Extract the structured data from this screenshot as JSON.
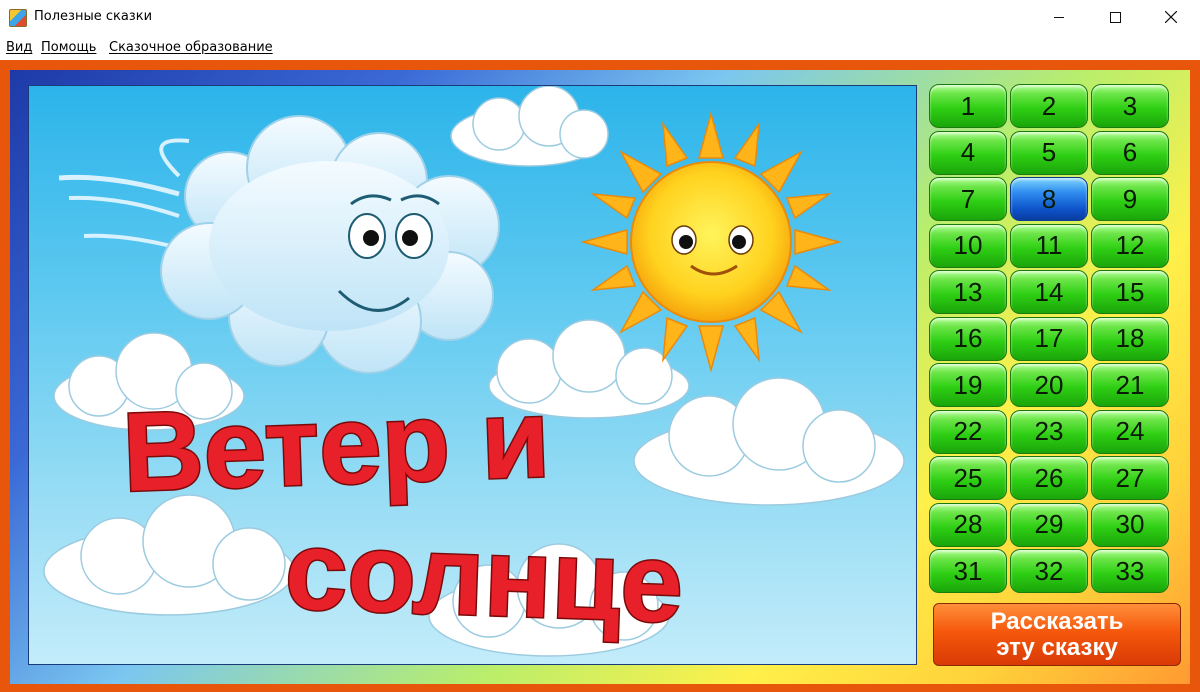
{
  "window": {
    "title": "Полезные сказки"
  },
  "menu": {
    "items": [
      {
        "key": "В",
        "rest": "ид"
      },
      {
        "key": "П",
        "rest": "омощь"
      },
      {
        "key": "С",
        "rest": "казочное образование"
      }
    ]
  },
  "scene": {
    "title_line1": "Ветер и",
    "title_line2": "солнце"
  },
  "stories": {
    "numbers": [
      "1",
      "2",
      "3",
      "4",
      "5",
      "6",
      "7",
      "8",
      "9",
      "10",
      "11",
      "12",
      "13",
      "14",
      "15",
      "16",
      "17",
      "18",
      "19",
      "20",
      "21",
      "22",
      "23",
      "24",
      "25",
      "26",
      "27",
      "28",
      "29",
      "30",
      "31",
      "32",
      "33"
    ],
    "selected": "8"
  },
  "tell_button": {
    "line1": "Рассказать",
    "line2": "эту сказку"
  },
  "colors": {
    "frame": "#e8560c",
    "title_text": "#e8202a",
    "number_button": "#2fcf14",
    "selected_button": "#0d52c8",
    "action_button": "#f5580c"
  }
}
